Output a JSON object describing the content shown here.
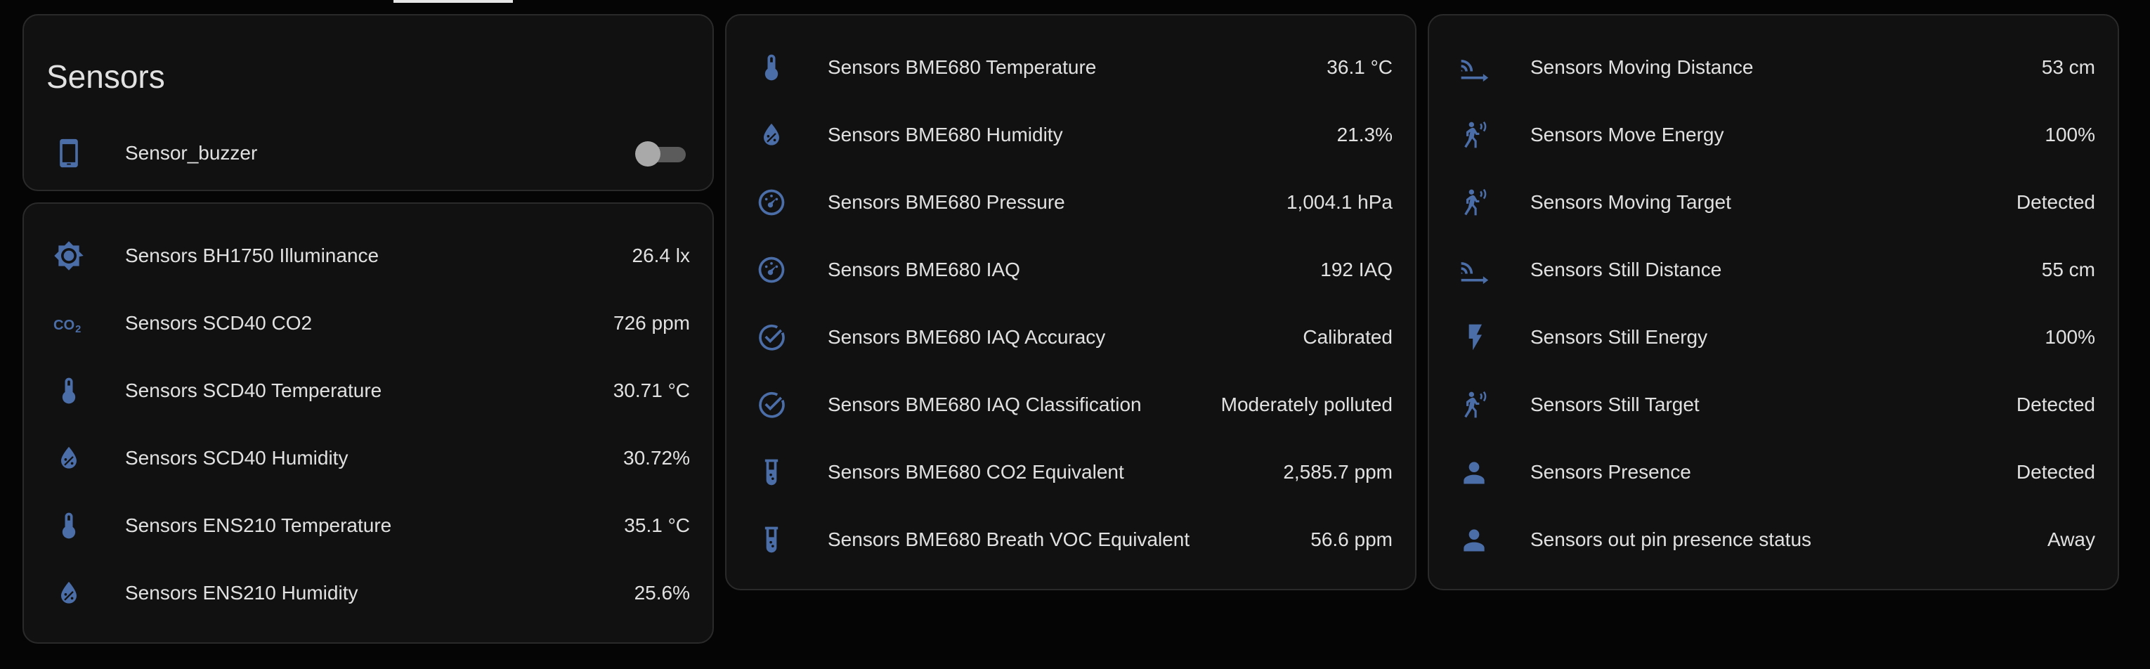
{
  "colors": {
    "icon": "#4b6ea9",
    "background": "#050505",
    "card": "#111111",
    "border": "#2a2a2a"
  },
  "card_header": {
    "title": "Sensors",
    "buzzer": {
      "label": "Sensor_buzzer",
      "icon": "cellphone-icon",
      "state": "off"
    }
  },
  "card_left": {
    "rows": [
      {
        "label": "Sensors BH1750 Illuminance",
        "value": "26.4 lx",
        "icon": "brightness-icon"
      },
      {
        "label": "Sensors SCD40 CO2",
        "value": "726 ppm",
        "icon": "co2-icon"
      },
      {
        "label": "Sensors SCD40 Temperature",
        "value": "30.71 °C",
        "icon": "thermometer-icon"
      },
      {
        "label": "Sensors SCD40 Humidity",
        "value": "30.72%",
        "icon": "water-percent-icon"
      },
      {
        "label": "Sensors ENS210 Temperature",
        "value": "35.1 °C",
        "icon": "thermometer-icon"
      },
      {
        "label": "Sensors ENS210 Humidity",
        "value": "25.6%",
        "icon": "water-percent-icon"
      }
    ]
  },
  "card_middle": {
    "rows": [
      {
        "label": "Sensors BME680 Temperature",
        "value": "36.1 °C",
        "icon": "thermometer-icon"
      },
      {
        "label": "Sensors BME680 Humidity",
        "value": "21.3%",
        "icon": "water-percent-icon"
      },
      {
        "label": "Sensors BME680 Pressure",
        "value": "1,004.1 hPa",
        "icon": "gauge-icon"
      },
      {
        "label": "Sensors BME680 IAQ",
        "value": "192 IAQ",
        "icon": "gauge-icon"
      },
      {
        "label": "Sensors BME680 IAQ Accuracy",
        "value": "Calibrated",
        "icon": "check-circle-icon"
      },
      {
        "label": "Sensors BME680 IAQ Classification",
        "value": "Moderately polluted",
        "icon": "check-circle-icon"
      },
      {
        "label": "Sensors BME680 CO2 Equivalent",
        "value": "2,585.7 ppm",
        "icon": "test-tube-icon"
      },
      {
        "label": "Sensors BME680 Breath VOC Equivalent",
        "value": "56.6 ppm",
        "icon": "test-tube-icon"
      }
    ]
  },
  "card_right": {
    "rows": [
      {
        "label": "Sensors Moving Distance",
        "value": "53 cm",
        "icon": "signal-distance-icon"
      },
      {
        "label": "Sensors Move Energy",
        "value": "100%",
        "icon": "motion-sensor-icon"
      },
      {
        "label": "Sensors Moving Target",
        "value": "Detected",
        "icon": "motion-sensor-icon"
      },
      {
        "label": "Sensors Still Distance",
        "value": "55 cm",
        "icon": "signal-distance-icon"
      },
      {
        "label": "Sensors Still Energy",
        "value": "100%",
        "icon": "flash-icon"
      },
      {
        "label": "Sensors Still Target",
        "value": "Detected",
        "icon": "motion-sensor-icon"
      },
      {
        "label": "Sensors Presence",
        "value": "Detected",
        "icon": "account-icon"
      },
      {
        "label": "Sensors out pin presence status",
        "value": "Away",
        "icon": "account-icon"
      }
    ]
  }
}
